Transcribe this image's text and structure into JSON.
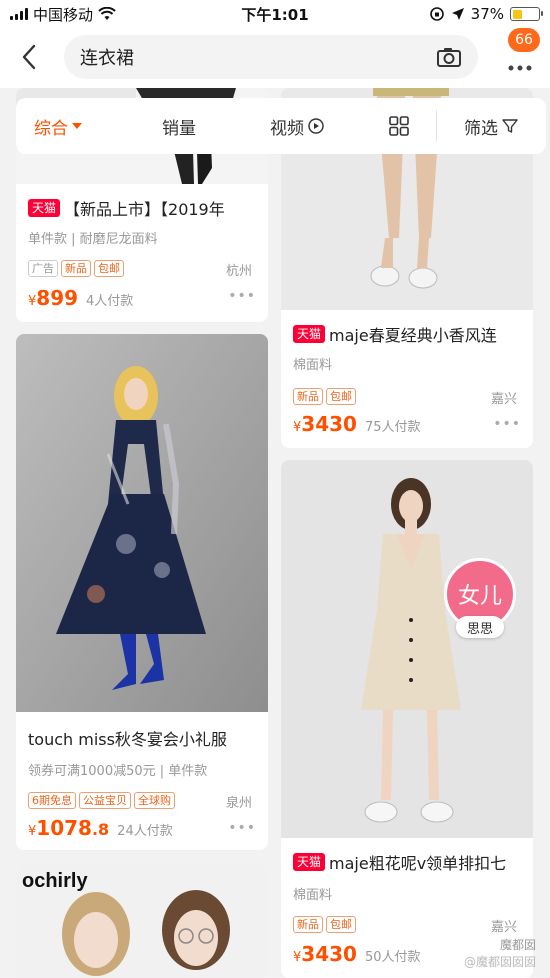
{
  "status": {
    "carrier": "中国移动",
    "time": "下午1:01",
    "battery": "37%"
  },
  "search": {
    "query": "连衣裙"
  },
  "notifications": {
    "count": "66"
  },
  "filters": {
    "comprehensive": "综合",
    "sales": "销量",
    "video": "视频",
    "screen": "筛选"
  },
  "cards": [
    {
      "title": "【新品上市】【2019年",
      "badge": "天猫",
      "desc": "单件款 | 耐磨尼龙面料",
      "tags": [
        "广告",
        "新品",
        "包邮"
      ],
      "location": "杭州",
      "price": "899",
      "sold": "4人付款"
    },
    {
      "title": "maje春夏经典小香风连",
      "badge": "天猫",
      "desc": "棉面料",
      "tags": [
        "新品",
        "包邮"
      ],
      "location": "嘉兴",
      "price": "3430",
      "sold": "75人付款"
    },
    {
      "title": "touch miss秋冬宴会小礼服",
      "desc": "领券可满1000减50元 | 单件款",
      "tags": [
        "6期免息",
        "公益宝贝",
        "全球购"
      ],
      "location": "泉州",
      "price": "1078",
      "price_dec": ".8",
      "sold": "24人付款"
    },
    {
      "title": "maje粗花呢v领单排扣七",
      "badge": "天猫",
      "desc": "棉面料",
      "tags": [
        "新品",
        "包邮"
      ],
      "location": "嘉兴",
      "price": "3430",
      "sold": "50人付款"
    },
    {
      "brand": "ochirly"
    }
  ],
  "yen": "¥",
  "float_badge": {
    "main": "女儿",
    "name": "思思"
  },
  "watermark": {
    "line1": "魔都囡",
    "line2": "@魔都囡囡囡"
  },
  "colors": {
    "accent": "#ff5000",
    "tmall": "#ff0036",
    "badge": "#ff6a1a"
  }
}
